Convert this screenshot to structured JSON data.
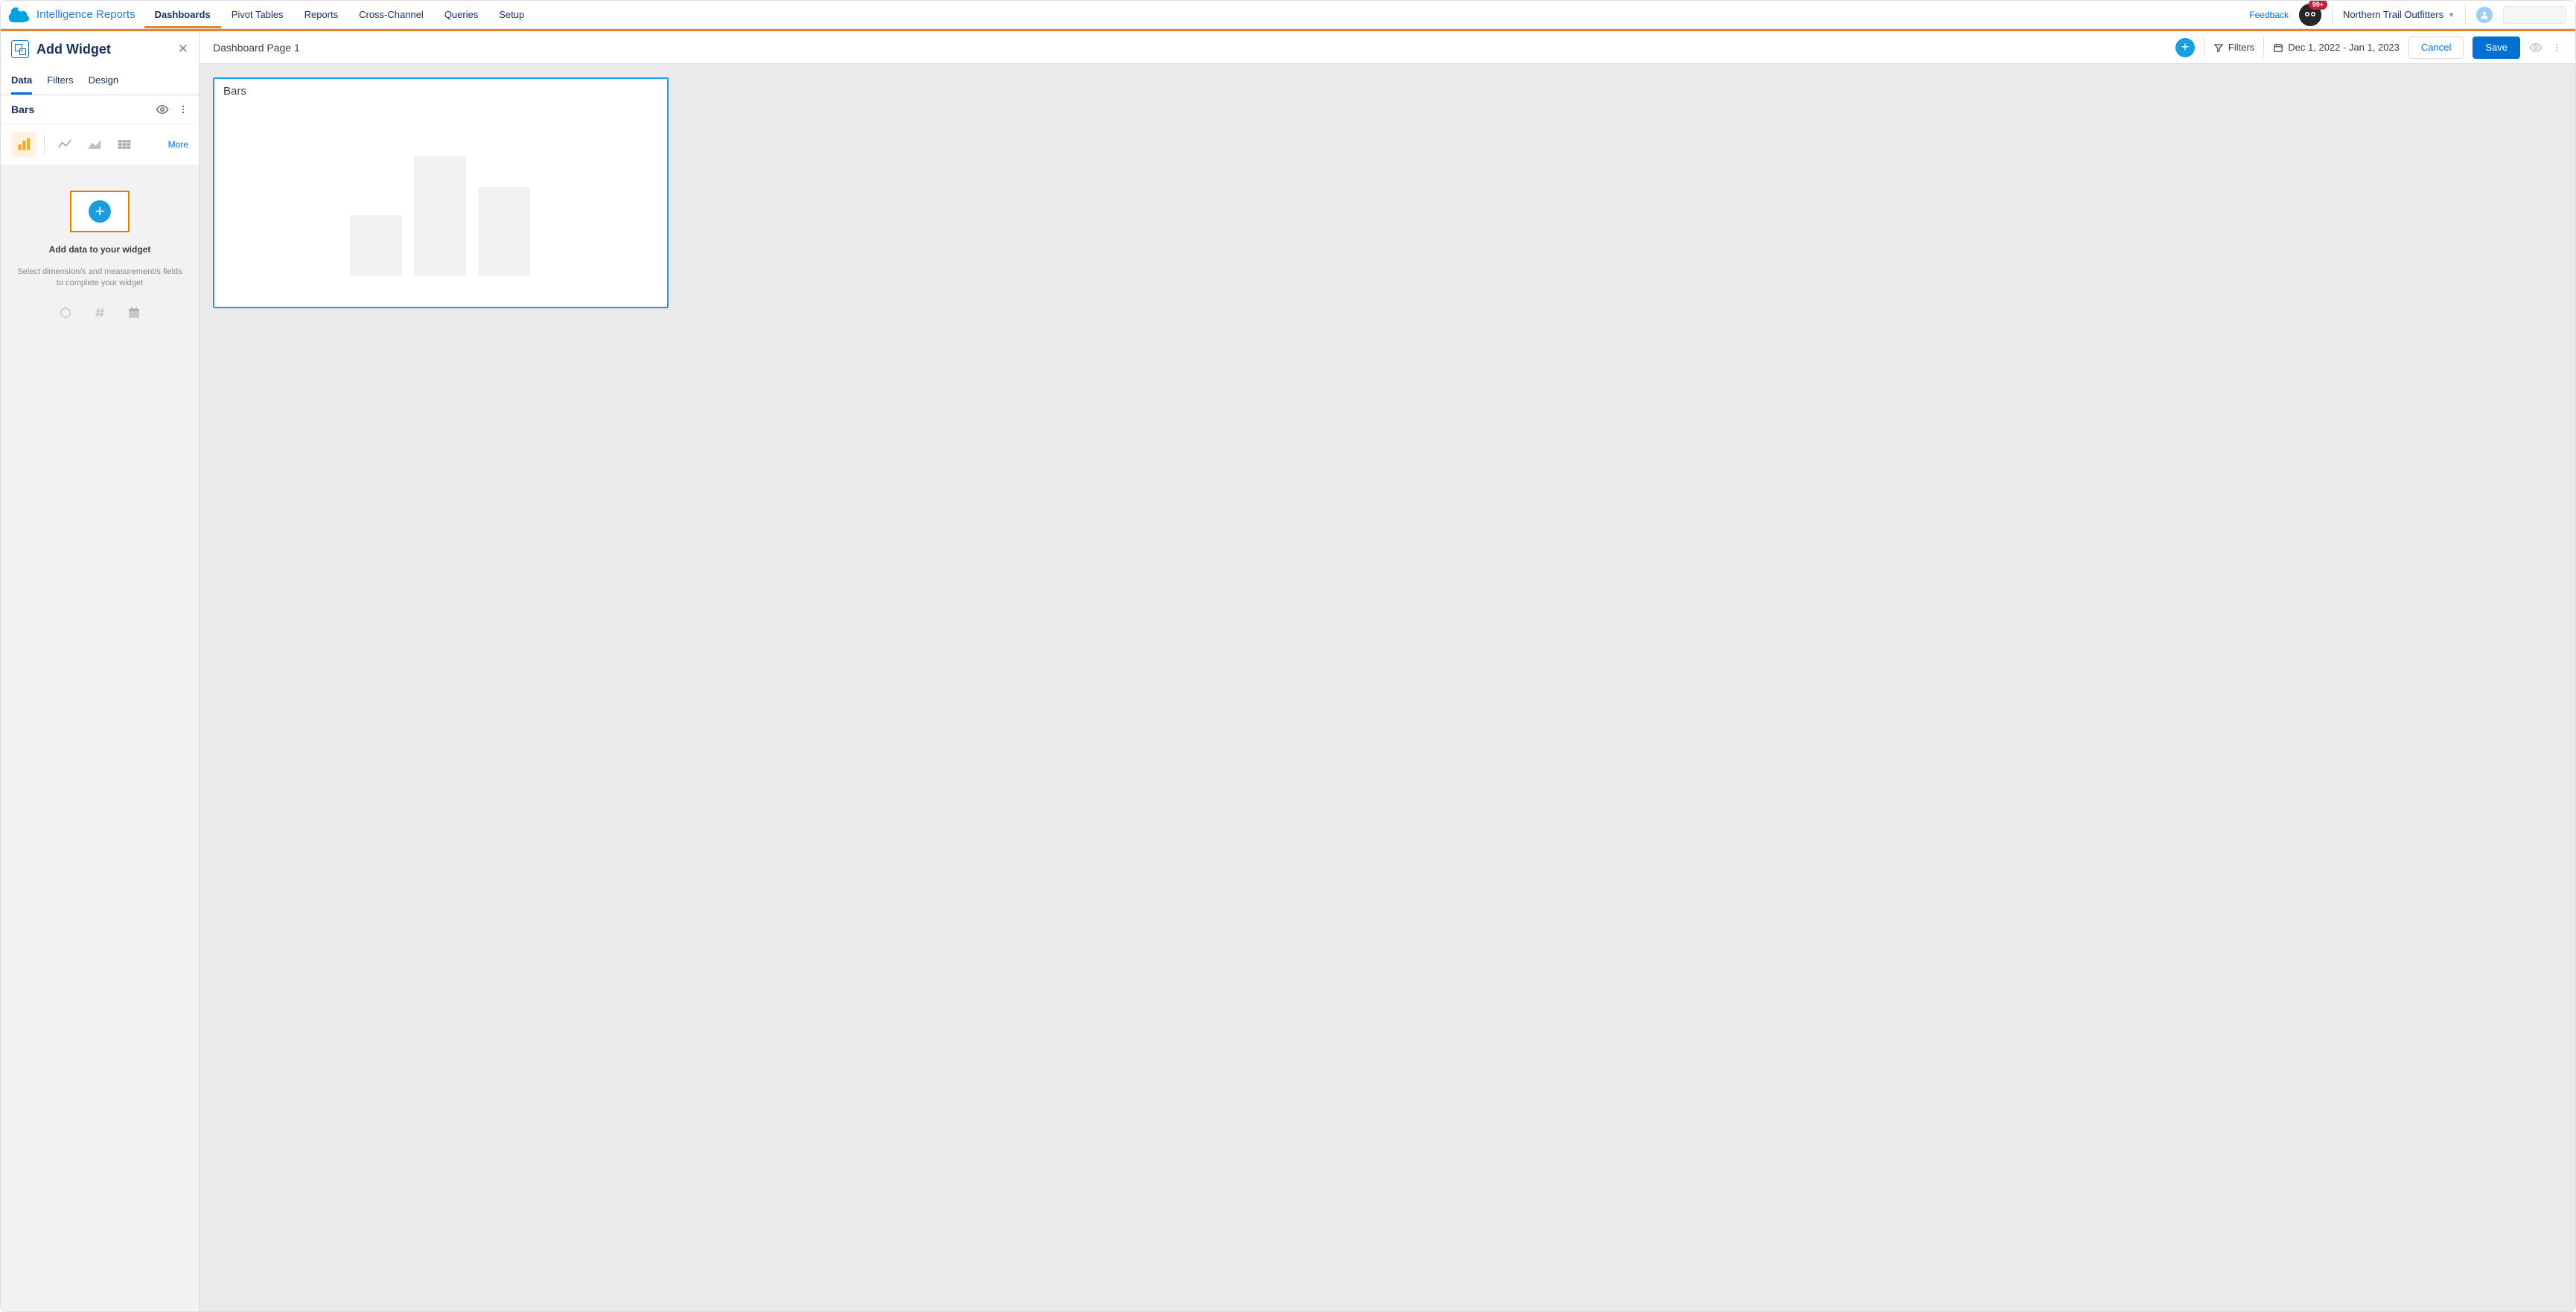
{
  "brand": {
    "name": "Intelligence Reports"
  },
  "nav": {
    "tabs": [
      "Dashboards",
      "Pivot Tables",
      "Reports",
      "Cross-Channel",
      "Queries",
      "Setup"
    ],
    "active_index": 0
  },
  "header_right": {
    "feedback": "Feedback",
    "notification_badge": "99+",
    "workspace": "Northern Trail Outfitters"
  },
  "panel": {
    "title": "Add Widget",
    "tabs": [
      "Data",
      "Filters",
      "Design"
    ],
    "active_tab_index": 0,
    "widget_name": "Bars",
    "more": "More",
    "empty": {
      "title": "Add data to your widget",
      "subtitle": "Select dimension/s and measurement/s fields to complete your widget"
    }
  },
  "toolbar": {
    "page_name": "Dashboard Page 1",
    "filters_label": "Filters",
    "date_range": "Dec 1, 2022 - Jan 1, 2023",
    "cancel": "Cancel",
    "save": "Save"
  },
  "widget_card": {
    "title": "Bars"
  }
}
